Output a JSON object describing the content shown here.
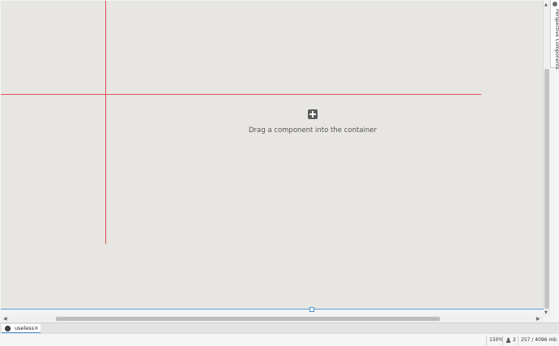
{
  "canvas": {
    "drop_hint": "Drag a component into the container",
    "add_icon": "plus-square-icon",
    "guide_color": "#d9534f",
    "selection_color": "#5aa0d8",
    "background_color": "#e8e6e3"
  },
  "side_panel": {
    "label": "Perspective Components",
    "icon": "component-icon"
  },
  "tabs": [
    {
      "label": "useless",
      "icon": "perspective-view-icon",
      "close": "×"
    }
  ],
  "status_bar": {
    "zoom": "150%",
    "users_count": "2",
    "memory": "257 / 4096 mb"
  },
  "scrollbars": {
    "up": "▲",
    "down": "▼",
    "left": "◀",
    "right": "▶"
  }
}
